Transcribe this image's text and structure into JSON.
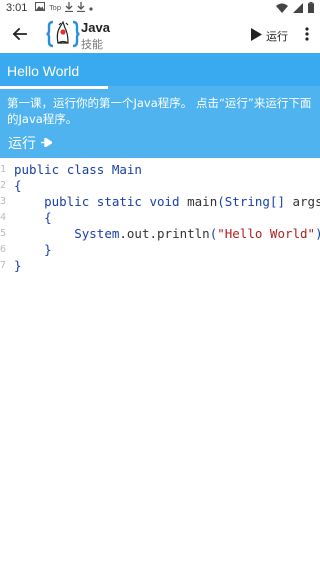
{
  "status_bar": {
    "time": "3:01",
    "icons": [
      "image-icon",
      "top-icon",
      "download-icon",
      "download-icon",
      "dot-icon"
    ],
    "top_text": "Top",
    "right_icons": [
      "wifi-icon",
      "signal-icon",
      "battery-icon"
    ]
  },
  "app_bar": {
    "title": "Java",
    "subtitle": "技能",
    "run_label": "运行"
  },
  "lesson": {
    "title": "Hello World",
    "description": "第一课，运行你的第一个Java程序。 点击“运行”来运行下面的Java程序。",
    "run_label": "运行"
  },
  "code": {
    "line_numbers": [
      "1",
      "2",
      "3",
      "4",
      "5",
      "6",
      "7"
    ],
    "line1_kw1": "public",
    "line1_kw2": "class",
    "line1_name": "Main",
    "line2": "{",
    "line3_kw1": "public",
    "line3_kw2": "static",
    "line3_kw3": "void",
    "line3_method": "main",
    "line3_open": "(",
    "line3_type": "String[]",
    "line3_arg": " args",
    "line3_close": ")",
    "line4": "{",
    "line5_sys": "System",
    "line5_dot1": ".",
    "line5_out": "out",
    "line5_dot2": ".",
    "line5_println": "println",
    "line5_open": "(",
    "line5_str": "\"Hello World\"",
    "line5_close": ");",
    "line6": "}",
    "line7": "}"
  },
  "colors": {
    "lesson_bg": "#4fb3f0",
    "lesson_head_bg": "#3aaaf0",
    "keyword": "#1a3fa8",
    "string": "#b02020"
  }
}
